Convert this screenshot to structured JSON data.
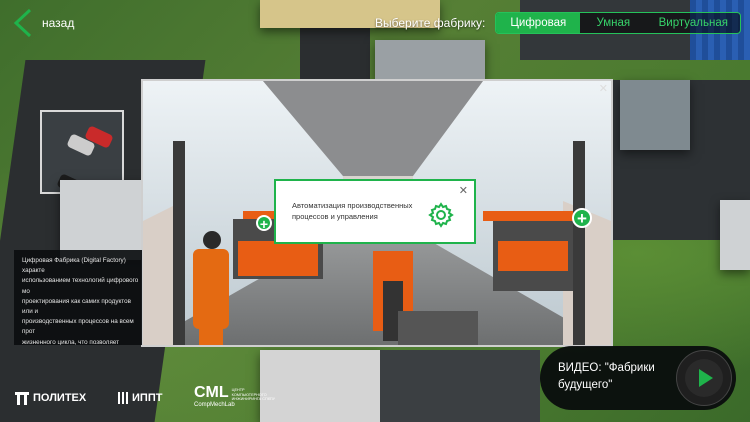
{
  "nav": {
    "back_label": "назад"
  },
  "factory_select": {
    "label": "Выберите фабрику:",
    "options": [
      "Цифровая",
      "Умная",
      "Виртуальная"
    ],
    "selected": "Цифровая"
  },
  "popup": {
    "text": "Автоматизация производственных процессов и управления",
    "icon": "gear-icon"
  },
  "description": {
    "text": "Цифровая Фабрика (Digital Factory) характе\nиспользованием технологий цифрового мо\nпроектирования как самих продуктов или и\nпроизводственных процессов на всем прот\nжизненного цикла, что позволяет радикаль\nсроки вывода на рынок и повысить интелл\nновых продуктов или изделий (машин, конс\nагрегатов, приборов, установок и т.д.)."
  },
  "logos": {
    "politech": "ПОЛИТЕХ",
    "ippt": "ИППТ",
    "cml": "CML",
    "cml_sub": "CompMechLab",
    "cml_small": "ЦЕНТР КОМПЬЮТЕРНОГО ИНЖИНИРИНГА СПбПУ"
  },
  "video": {
    "label": "ВИДЕО: \"Фабрики будущего\""
  },
  "colors": {
    "accent": "#1fb34b",
    "accent_light": "#37d36a",
    "overlay": "#0c0e10"
  }
}
